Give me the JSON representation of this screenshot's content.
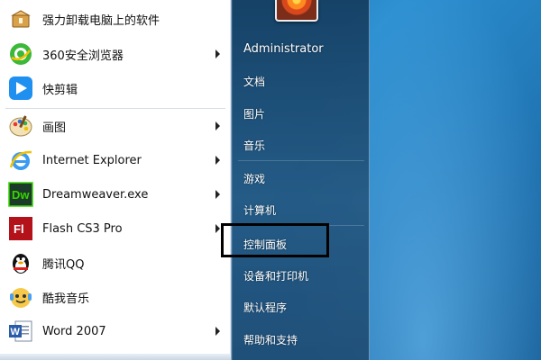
{
  "left_pane": {
    "programs": [
      {
        "label": "强力卸载电脑上的软件",
        "icon": "uninstaller-box-icon",
        "has_submenu": false
      },
      {
        "label": "360安全浏览器",
        "icon": "360-browser-icon",
        "has_submenu": true
      },
      {
        "label": "快剪辑",
        "icon": "kuaijianji-play-icon",
        "has_submenu": false
      },
      {
        "label": "画图",
        "icon": "paint-palette-icon",
        "has_submenu": true
      },
      {
        "label": "Internet Explorer",
        "icon": "internet-explorer-icon",
        "has_submenu": true
      },
      {
        "label": "Dreamweaver.exe",
        "icon": "dreamweaver-icon",
        "icon_text": "Dw",
        "has_submenu": true
      },
      {
        "label": "Flash CS3 Pro",
        "icon": "flash-icon",
        "icon_text": "Fl",
        "has_submenu": true
      },
      {
        "label": "腾讯QQ",
        "icon": "qq-penguin-icon",
        "has_submenu": false
      },
      {
        "label": "酷我音乐",
        "icon": "kuwo-music-icon",
        "has_submenu": false
      },
      {
        "label": "Word 2007",
        "icon": "word-2007-icon",
        "icon_text": "W",
        "has_submenu": true
      }
    ]
  },
  "right_pane": {
    "user_name": "Administrator",
    "items": [
      {
        "label": "文档"
      },
      {
        "label": "图片"
      },
      {
        "label": "音乐"
      },
      {
        "label": "游戏"
      },
      {
        "label": "计算机"
      },
      {
        "label": "控制面板"
      },
      {
        "label": "设备和打印机"
      },
      {
        "label": "默认程序"
      },
      {
        "label": "帮助和支持"
      }
    ]
  },
  "colors": {
    "highlight_box": "#000000",
    "right_pane_text": "#ffffff",
    "dreamweaver": "#35d400",
    "flash": "#b3121a",
    "word": "#2a5caa"
  }
}
